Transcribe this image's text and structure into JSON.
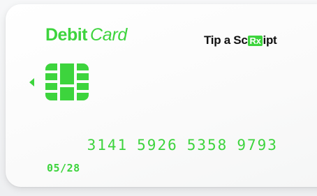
{
  "card": {
    "brand_bold": "Debit",
    "brand_italic": "Card",
    "logo": {
      "part1": "Tip a Sc",
      "part2": "Rx",
      "part3": "ipt"
    },
    "number_groups": [
      "3141",
      "5926",
      "5358",
      "9793"
    ],
    "expiry": "05/28",
    "colors": {
      "accent": "#3dd43d",
      "card_bg": "#ffffff",
      "logo_text": "#111111"
    },
    "icons": {
      "chip": "card-chip-icon",
      "arrow": "caret-left-icon"
    }
  }
}
